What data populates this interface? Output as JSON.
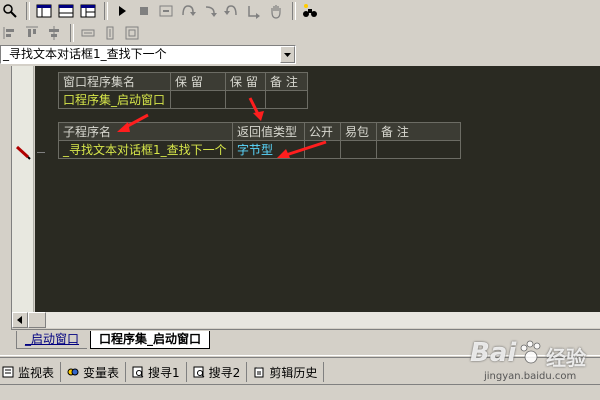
{
  "toolbar": {
    "dropdown_value": "_寻找文本对话框1_查找下一个"
  },
  "tables": {
    "assembly": {
      "headers": [
        "窗口程序集名",
        "保 留",
        "保 留",
        "备 注"
      ],
      "row": [
        "口程序集_启动窗口",
        "",
        "",
        ""
      ]
    },
    "subroutine": {
      "headers": [
        "子程序名",
        "返回值类型",
        "公开",
        "易包",
        "备 注"
      ],
      "row": [
        "_寻找文本对话框1_查找下一个",
        "字节型",
        "",
        "",
        ""
      ]
    }
  },
  "editor_tabs": [
    "_启动窗口",
    "口程序集_启动窗口"
  ],
  "bottom_tabs": [
    "监视表",
    "变量表",
    "搜寻1",
    "搜寻2",
    "剪辑历史"
  ],
  "watermark": {
    "brand": "Bai",
    "brand2": "经验",
    "url": "jingyan.baidu.com"
  },
  "colors": {
    "editor_bg": "#2a2a22",
    "name_text": "#d7e64a",
    "type_text": "#5ad8ff",
    "arrow": "#ff1e1e"
  }
}
